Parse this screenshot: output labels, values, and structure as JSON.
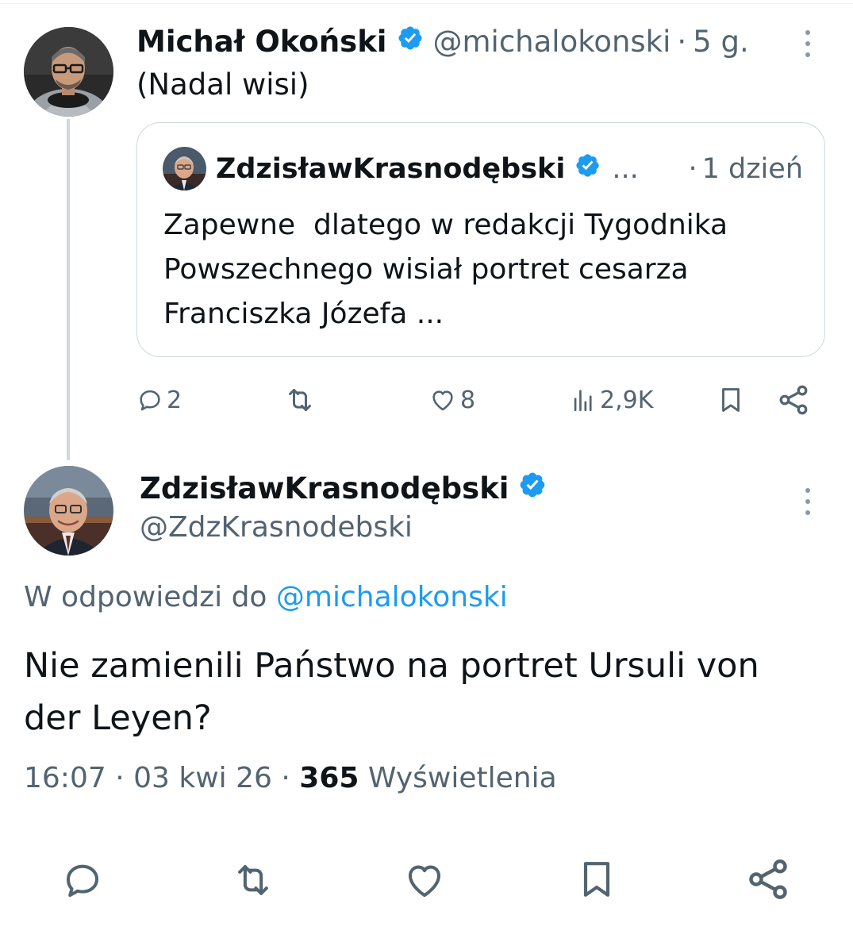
{
  "post1": {
    "author_name": "Michał Okoński",
    "handle": "@michalokonski",
    "separator": "·",
    "time": "5 g.",
    "text": "(Nadal wisi)"
  },
  "quote": {
    "author_name": "ZdzisławKrasnodębski",
    "ellipsis": "...",
    "separator": "·",
    "time": "1 dzień",
    "line1": "Zapewne  dlatego w redakcji Tygodnika",
    "line2": "Powszechnego wisiał portret cesarza",
    "line3": "Franciszka Józefa ..."
  },
  "post1_actions": {
    "replies": "2",
    "likes": "8",
    "views": "2,9K"
  },
  "main_post": {
    "author_name": "ZdzisławKrasnodębski",
    "handle": "@ZdzKrasnodebski",
    "reply_prefix": "W odpowiedzi do",
    "reply_to": "@michalokonski",
    "text_line1": "Nie zamienili Państwo na portret Ursuli von",
    "text_line2": "der Leyen?",
    "time": "16:07",
    "sep1": "·",
    "date": "03 kwi 26",
    "sep2": "·",
    "views_count": "365",
    "views_label": "Wyświetlenia"
  },
  "colors": {
    "accent": "#1d9bf0",
    "secondary_text": "#536471",
    "border": "#cfd9de"
  },
  "icons": [
    "verified-badge-icon",
    "more-icon",
    "reply-icon",
    "retweet-icon",
    "like-icon",
    "views-icon",
    "bookmark-icon",
    "share-icon"
  ]
}
